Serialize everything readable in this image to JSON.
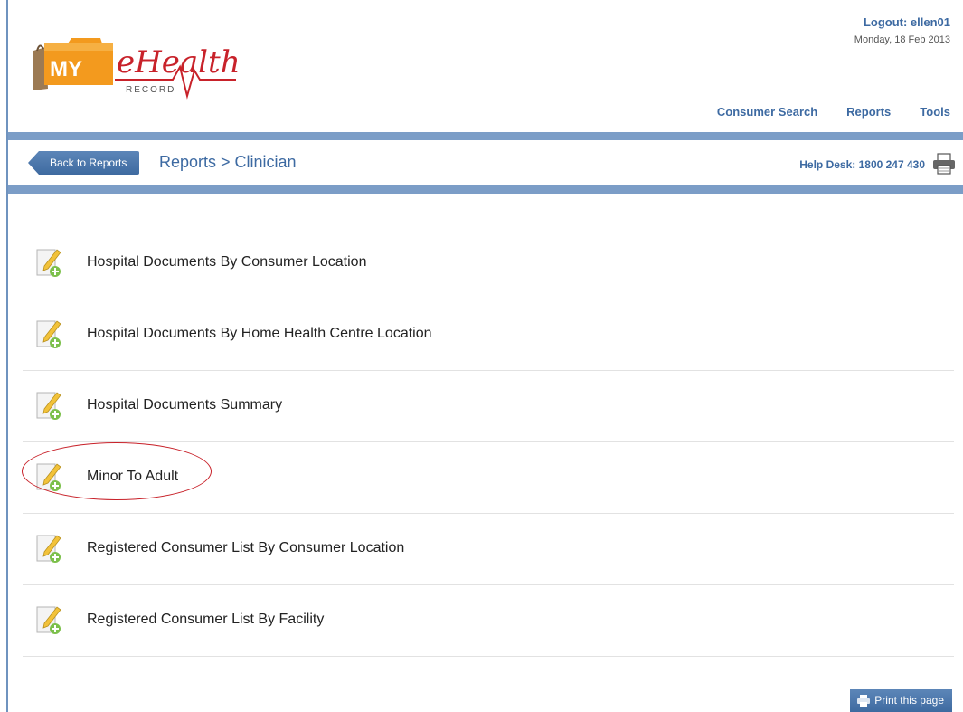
{
  "header": {
    "logo_my": "MY",
    "logo_ehealth": "eHealth",
    "logo_record": "RECORD",
    "logout": "Logout: ellen01",
    "date": "Monday, 18 Feb 2013",
    "nav": [
      "Consumer Search",
      "Reports",
      "Tools"
    ]
  },
  "breadcrumb": {
    "back_label": "Back to Reports",
    "path": "Reports > Clinician",
    "helpdesk": "Help Desk: 1800 247 430"
  },
  "reports": [
    {
      "label": "Hospital Documents By Consumer Location",
      "icon": "edit-report-icon"
    },
    {
      "label": "Hospital Documents By Home Health Centre Location",
      "icon": "edit-report-icon"
    },
    {
      "label": "Hospital Documents Summary",
      "icon": "edit-report-icon"
    },
    {
      "label": "Minor To Adult",
      "icon": "edit-report-icon",
      "highlighted": true
    },
    {
      "label": "Registered Consumer List By Consumer Location",
      "icon": "edit-report-icon"
    },
    {
      "label": "Registered Consumer List By Facility",
      "icon": "edit-report-icon"
    }
  ],
  "footer": {
    "print_label": "Print this page"
  },
  "colors": {
    "brand_blue": "#3d6aa2",
    "band_blue": "#7b9dc7",
    "highlight_red": "#c8222a",
    "logo_orange": "#f39a1e"
  }
}
